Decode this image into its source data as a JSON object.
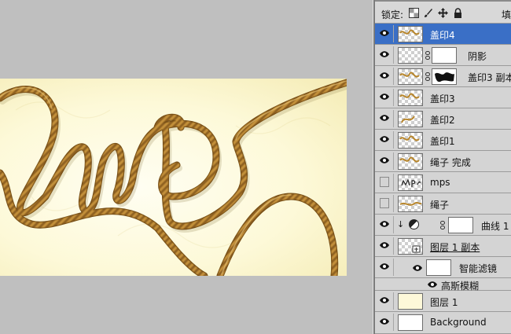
{
  "panel": {
    "lock_label": "锁定:",
    "fill_label": "填",
    "lock_icons": [
      "lock-transparent-icon",
      "lock-paint-icon",
      "lock-move-icon",
      "lock-all-icon"
    ]
  },
  "layers": [
    {
      "name": "盖印4",
      "visible": true,
      "selected": true,
      "thumb": "rope"
    },
    {
      "name": "阴影",
      "visible": true,
      "selected": false,
      "thumb": "transparent",
      "mask": "white"
    },
    {
      "name": "盖印3 副本",
      "visible": true,
      "selected": false,
      "thumb": "rope",
      "mask": "black-shape"
    },
    {
      "name": "盖印3",
      "visible": true,
      "selected": false,
      "thumb": "rope"
    },
    {
      "name": "盖印2",
      "visible": true,
      "selected": false,
      "thumb": "rope"
    },
    {
      "name": "盖印1",
      "visible": true,
      "selected": false,
      "thumb": "rope"
    },
    {
      "name": "绳子 完成",
      "visible": true,
      "selected": false,
      "thumb": "rope"
    },
    {
      "name": "mps",
      "visible": false,
      "selected": false,
      "thumb": "text-mps"
    },
    {
      "name": "绳子",
      "visible": false,
      "selected": false,
      "thumb": "rope"
    },
    {
      "name": "曲线 1",
      "visible": true,
      "selected": false,
      "thumb": "adjustment",
      "clipped": true
    },
    {
      "name": "图层 1 副本",
      "visible": true,
      "selected": false,
      "thumb": "smart-object"
    },
    {
      "name": "智能滤镜",
      "visible": true,
      "selected": false,
      "thumb": "white",
      "sub": "smart-filter"
    },
    {
      "name": "高斯模糊",
      "visible": true,
      "selected": false,
      "sub": "filter-item"
    },
    {
      "name": "图层 1",
      "visible": true,
      "selected": false,
      "thumb": "cream"
    },
    {
      "name": "Background",
      "visible": true,
      "selected": false,
      "thumb": "white"
    }
  ],
  "colors": {
    "selected_row": "#3a6fc6",
    "rope": "#b8862c",
    "canvas_bg": "#fdf9d8"
  }
}
